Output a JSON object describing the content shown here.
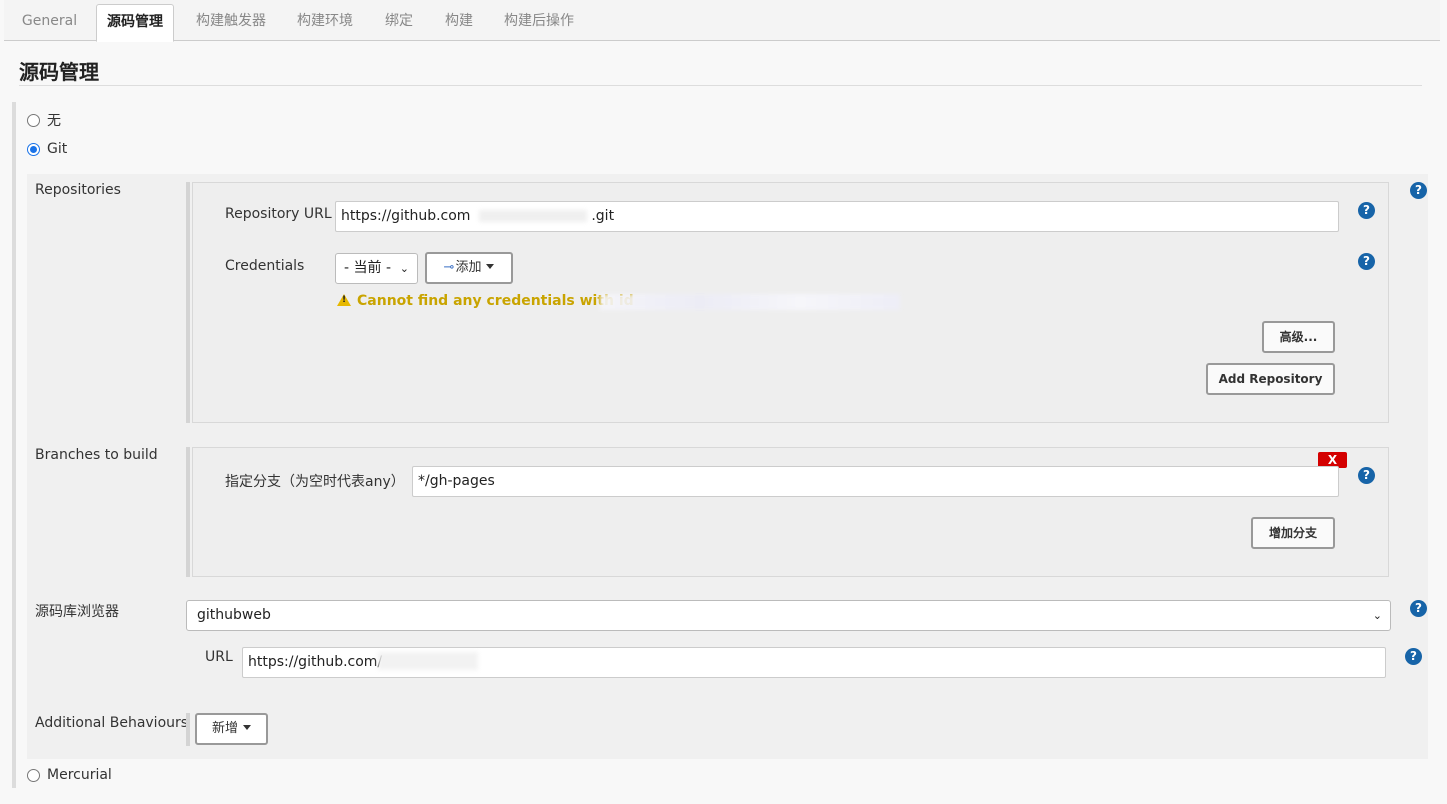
{
  "tabs": [
    {
      "label": "General",
      "active": false
    },
    {
      "label": "源码管理",
      "active": true
    },
    {
      "label": "构建触发器",
      "active": false
    },
    {
      "label": "构建环境",
      "active": false
    },
    {
      "label": "绑定",
      "active": false
    },
    {
      "label": "构建",
      "active": false
    },
    {
      "label": "构建后操作",
      "active": false
    }
  ],
  "section": {
    "title": "源码管理"
  },
  "scm_options": {
    "none_label": "无",
    "git_label": "Git",
    "mercurial_label": "Mercurial",
    "selected": "Git"
  },
  "repositories": {
    "label": "Repositories",
    "url_label": "Repository URL",
    "url_value_prefix": "https://github.com",
    "url_value_suffix": ".git",
    "credentials_label": "Credentials",
    "credentials_select": "- 当前 -",
    "add_button": "添加",
    "warning": "Cannot find any credentials with id",
    "advanced_button": "高级...",
    "add_repository_button": "Add Repository"
  },
  "branches": {
    "label": "Branches to build",
    "branch_label": "指定分支（为空时代表any）",
    "branch_value": "*/gh-pages",
    "delete_label": "X",
    "add_branch_button": "增加分支"
  },
  "repo_browser": {
    "label": "源码库浏览器",
    "selected": "githubweb",
    "url_label": "URL",
    "url_value": "https://github.com/"
  },
  "additional": {
    "label": "Additional Behaviours",
    "add_button": "新增"
  },
  "help_glyph": "?",
  "colors": {
    "help": "#1764a8",
    "warning_text": "#c9a400",
    "delete": "#d40000",
    "radio_checked": "#1a73e8"
  }
}
